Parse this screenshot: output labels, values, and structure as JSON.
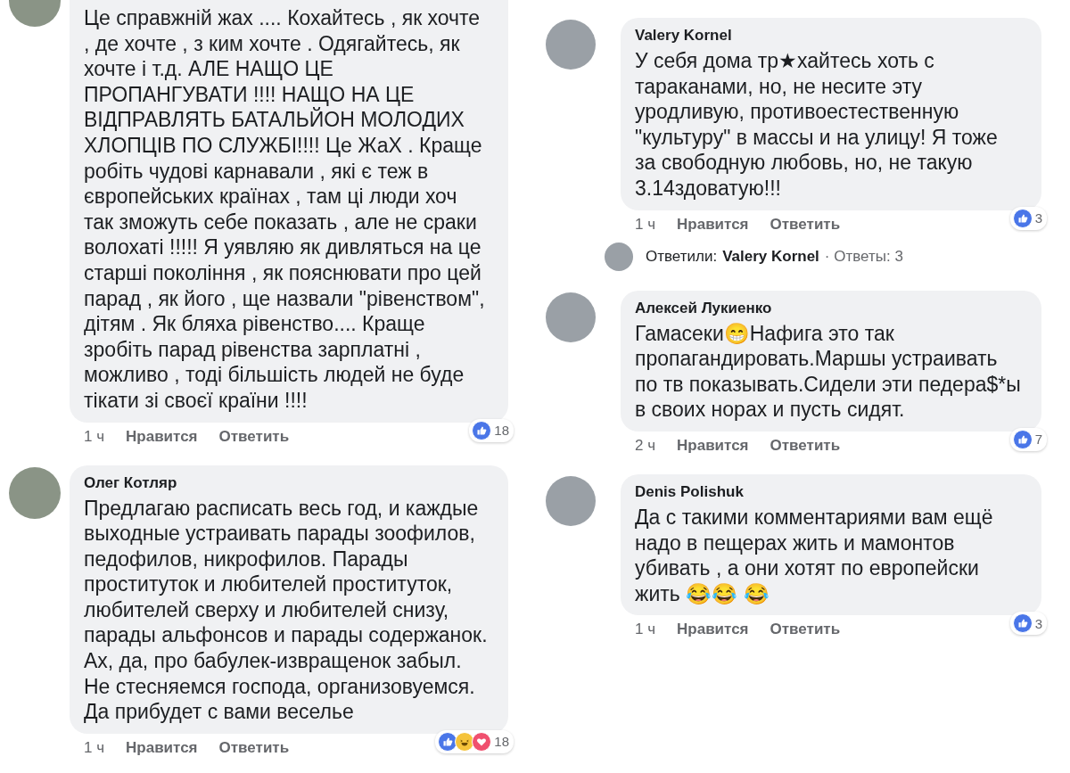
{
  "columns": [
    {
      "comments": [
        {
          "text": "Це справжній жах .... Кохайтесь , як хочте , де хочте , з ким хочте . Одягайтесь, як хочте і т.д. АЛЕ НАЩО ЦЕ ПРОПАНГУВАТИ !!!! НАЩО НА ЦЕ ВІДПРАВЛЯТЬ БАТАЛЬЙОН МОЛОДИХ ХЛОПЦІВ ПО СЛУЖБІ!!!! Це ЖаХ . Краще робіть чудові карнавали , які є теж в європейських країнах , там ці люди хоч так зможуть себе показать , але не сраки волохаті !!!!! Я уявляю як дивляться на це старші покоління , як пояснювати про цей парад , як його , ще назвали \"рівенством\", дітям . Як бляха рівенство.... Краще зробіть парад рівенства зарплатні , можливо , тоді більшість людей не буде тікати зі своєї країни !!!!",
          "time": "1 ч",
          "like": "Нравится",
          "reply": "Ответить",
          "reactions": [
            {
              "kind": "like"
            }
          ],
          "count": "18"
        },
        {
          "author": "Олег Котляр",
          "text": "Предлагаю расписать весь год, и каждые выходные устраивать парады зоофилов, педофилов, никрофилов. Парады проституток и любителей проституток, любителей сверху и любителей снизу, парады альфонсов и парады содержанок. Ах, да, про бабулек-извращенок забыл. Не стесняемся господа, организовуемся. Да прибудет с вами веселье",
          "time": "1 ч",
          "like": "Нравится",
          "reply": "Ответить",
          "reactions": [
            {
              "kind": "like"
            },
            {
              "kind": "haha"
            },
            {
              "kind": "love"
            }
          ],
          "count": "18"
        }
      ]
    },
    {
      "comments": [
        {
          "author": "Valery Kornel",
          "text": "У себя дома тр★хайтесь хоть с тараканами, но, не несите эту уродливую, противоестественную \"культуру\" в массы и  на улицу! Я тоже за свободную любовь, но, не такую 3.14здоватую!!!",
          "time": "1 ч",
          "like": "Нравится",
          "reply": "Ответить",
          "reactions": [
            {
              "kind": "like"
            }
          ],
          "count": "3",
          "replies": {
            "label": "Ответили:",
            "name": "Valery Kornel",
            "count": "· Ответы: 3"
          }
        },
        {
          "author": "Алексей Лукиенко",
          "text": "Гамасеки😁Нафига это так пропагандировать.Маршы устраивать по тв показывать.Сидели эти педера$*ы в своих норах и пусть сидят.",
          "time": "2 ч",
          "like": "Нравится",
          "reply": "Ответить",
          "reactions": [
            {
              "kind": "like"
            }
          ],
          "count": "7"
        },
        {
          "author": "Denis Polishuk",
          "text": "Да с такими комментариями вам ещё надо в пещерах жить и мамонтов убивать , а они хотят по европейски жить 😂😂 😂",
          "time": "1 ч",
          "like": "Нравится",
          "reply": "Ответить",
          "reactions": [
            {
              "kind": "like"
            }
          ],
          "count": "3"
        }
      ]
    }
  ]
}
